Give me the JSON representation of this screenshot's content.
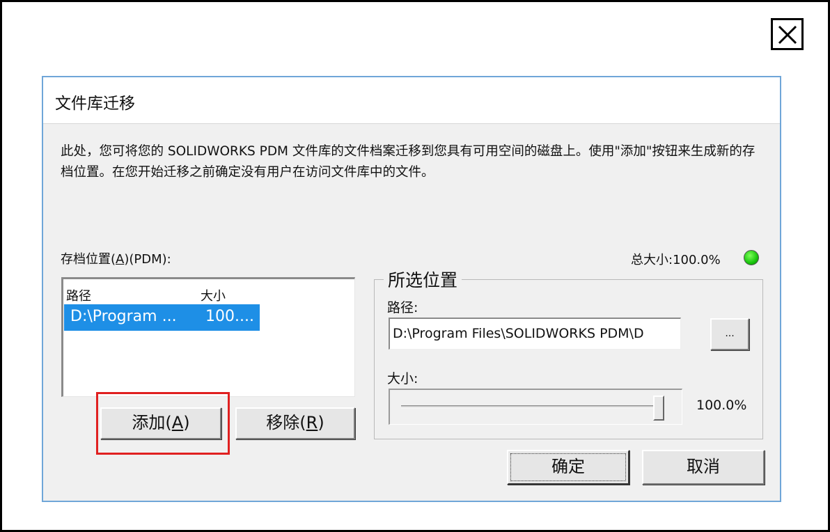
{
  "overlay": {
    "close_icon": "close-icon"
  },
  "dialog": {
    "title": "文件库迁移",
    "description": "此处，您可将您的 SOLIDWORKS PDM 文件库的文件档案迁移到您具有可用空间的磁盘上。使用\"添加\"按钮来生成新的存档位置。在您开始迁移之前确定没有用户在访问文件库中的文件。",
    "archive_label_pre": "存档位置(",
    "archive_label_key": "A",
    "archive_label_post": ")(PDM):",
    "total_size": "总大小:100.0%",
    "status_color": "#18c40c",
    "list": {
      "columns": [
        "路径",
        "大小"
      ],
      "rows": [
        {
          "path": "D:\\Program ...",
          "size": "100....",
          "selected": true
        }
      ]
    },
    "add_button": {
      "label": "添加(",
      "key": "A",
      "suffix": ")"
    },
    "remove_button": {
      "label": "移除(",
      "key": "R",
      "suffix": ")"
    },
    "selected_location": {
      "group_title": "所选位置",
      "path_label": "路径:",
      "path_value": "D:\\Program Files\\SOLIDWORKS PDM\\D",
      "browse_label": "...",
      "size_label": "大小:",
      "size_value": "100.0%",
      "size_fraction": 1.0
    },
    "ok_label": "确定",
    "cancel_label": "取消",
    "highlight_color": "#e02020"
  }
}
